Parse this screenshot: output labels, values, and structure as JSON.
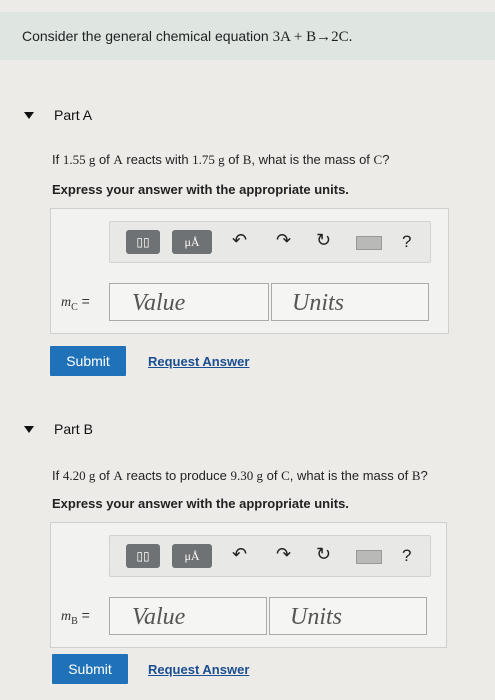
{
  "header": {
    "prefix": "Consider the general chemical equation ",
    "equation": "3A + B→2C."
  },
  "partA": {
    "title": "Part A",
    "question": {
      "p1": "If ",
      "m1": "1.55 g",
      "p2": " of ",
      "s1": "A",
      "p3": " reacts with ",
      "m2": "1.75 g",
      "p4": " of ",
      "s2": "B",
      "p5": ", what is the mass of ",
      "s3": "C",
      "p6": "?"
    },
    "instruction": "Express your answer with the appropriate units.",
    "toolbar": {
      "template_btn": "▯▯",
      "units_btn": "μÅ",
      "undo": "↶",
      "redo": "↷",
      "reset": "↻",
      "help": "?"
    },
    "var_label": "m",
    "var_sub": "C",
    "value_placeholder": "Value",
    "units_placeholder": "Units",
    "submit_label": "Submit",
    "request_label": "Request Answer"
  },
  "partB": {
    "title": "Part B",
    "question": {
      "p1": "If ",
      "m1": "4.20 g",
      "p2": " of ",
      "s1": "A",
      "p3": " reacts to produce ",
      "m2": "9.30 g",
      "p4": " of ",
      "s2": "C",
      "p5": ", what is the mass of ",
      "s3": "B",
      "p6": "?"
    },
    "instruction": "Express your answer with the appropriate units.",
    "toolbar": {
      "template_btn": "▯▯",
      "units_btn": "μÅ",
      "undo": "↶",
      "redo": "↷",
      "reset": "↻",
      "help": "?"
    },
    "var_label": "m",
    "var_sub": "B",
    "value_placeholder": "Value",
    "units_placeholder": "Units",
    "submit_label": "Submit",
    "request_label": "Request Answer"
  },
  "colors": {
    "submit_bg": "#1f72b8",
    "link": "#1a4e91",
    "header_bg": "#dfe6e2"
  }
}
